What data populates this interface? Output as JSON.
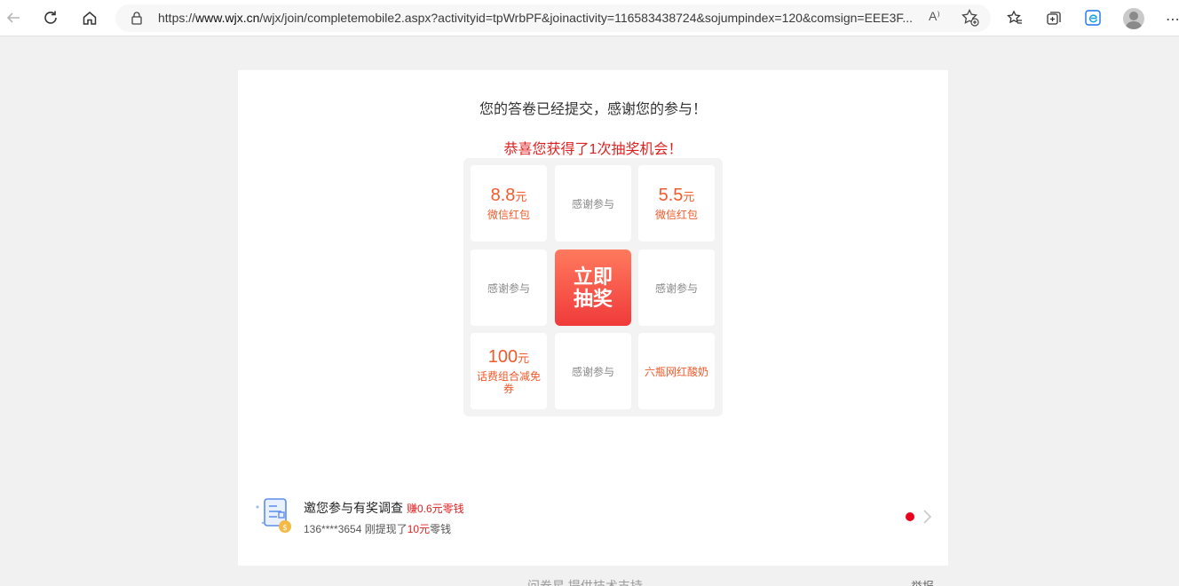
{
  "browser": {
    "url_prefix": "https://",
    "url_host": "www.wjx.cn",
    "url_path": "/wjx/join/completemobile2.aspx?activityid=tpWrbPF&joinactivity=116583438724&sojumpindex=120&comsign=EEE3F...",
    "read_aloud_label": "A⁾",
    "icons": [
      "back-icon",
      "refresh-icon",
      "home-icon",
      "lock-icon",
      "read-aloud-icon",
      "add-favorite-icon",
      "favorites-icon",
      "collections-icon",
      "edge-icon",
      "profile-icon",
      "more-icon"
    ]
  },
  "page": {
    "submitted_text": "您的答卷已经提交，感谢您的参与！",
    "congrats_text": "恭喜您获得了1次抽奖机会！",
    "lottery": {
      "cells": [
        {
          "type": "cash",
          "amount": "8.8",
          "unit": "元",
          "label": "微信红包"
        },
        {
          "type": "thanks",
          "label": "感谢参与"
        },
        {
          "type": "cash",
          "amount": "5.5",
          "unit": "元",
          "label": "微信红包"
        },
        {
          "type": "thanks",
          "label": "感谢参与"
        },
        {
          "type": "draw",
          "label": "立即抽奖"
        },
        {
          "type": "thanks",
          "label": "感谢参与"
        },
        {
          "type": "cash",
          "amount": "100",
          "unit": "元",
          "label": "话费组合减免券"
        },
        {
          "type": "thanks",
          "label": "感谢参与"
        },
        {
          "type": "prize",
          "label": "六瓶网红酸奶"
        }
      ]
    },
    "promo": {
      "title": "邀您参与有奖调查",
      "earn": "赚0.6元零钱",
      "line2_prefix": "136****3654 刚提现了",
      "line2_amount": "10元",
      "line2_suffix": "零钱"
    },
    "footer": {
      "brand": "问卷星 提供技术支持",
      "report": "举报"
    }
  },
  "colors": {
    "accent_red": "#e02020",
    "prize_orange": "#f15a2b",
    "draw_gradient_top": "#ff7a5e",
    "draw_gradient_bottom": "#f03a3a",
    "dot_red": "#e8001c"
  }
}
